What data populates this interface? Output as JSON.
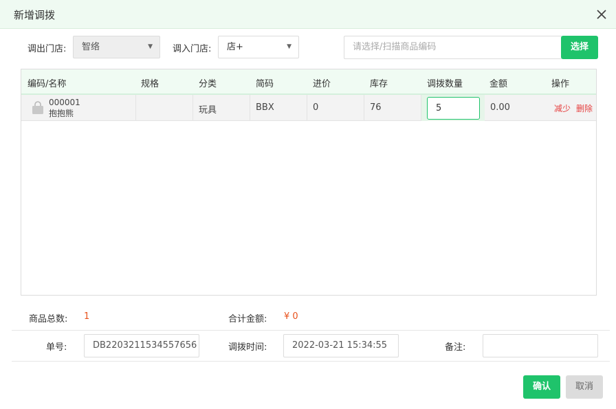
{
  "dialog": {
    "title": "新增调拨"
  },
  "filters": {
    "out_store_label": "调出门店:",
    "out_store_value": "智络",
    "in_store_label": "调入门店:",
    "in_store_value": "店+",
    "search_placeholder": "请选择/扫描商品编码",
    "select_button": "选择"
  },
  "table": {
    "headers": [
      "编码/名称",
      "规格",
      "分类",
      "简码",
      "进价",
      "库存",
      "调拨数量",
      "金额",
      "操作"
    ],
    "rows": [
      {
        "code": "000001",
        "name": "抱抱熊",
        "spec": "",
        "category": "玩具",
        "short_code": "BBX",
        "price": "0",
        "stock": "76",
        "quantity": "5",
        "amount": "0.00",
        "action_reduce": "减少",
        "action_delete": "删除"
      }
    ]
  },
  "summary": {
    "total_items_label": "商品总数:",
    "total_items_value": "1",
    "total_amount_label": "合计金额:",
    "total_amount_value": "¥ 0"
  },
  "form": {
    "order_no_label": "单号:",
    "order_no_value": "DB2203211534557656",
    "time_label": "调拨时间:",
    "time_value": "2022-03-21 15:34:55",
    "remark_label": "备注:",
    "remark_value": ""
  },
  "footer": {
    "confirm": "确认",
    "cancel": "取消"
  },
  "colors": {
    "accent": "#1fc36b",
    "danger": "#e64040",
    "value": "#e8521c"
  }
}
